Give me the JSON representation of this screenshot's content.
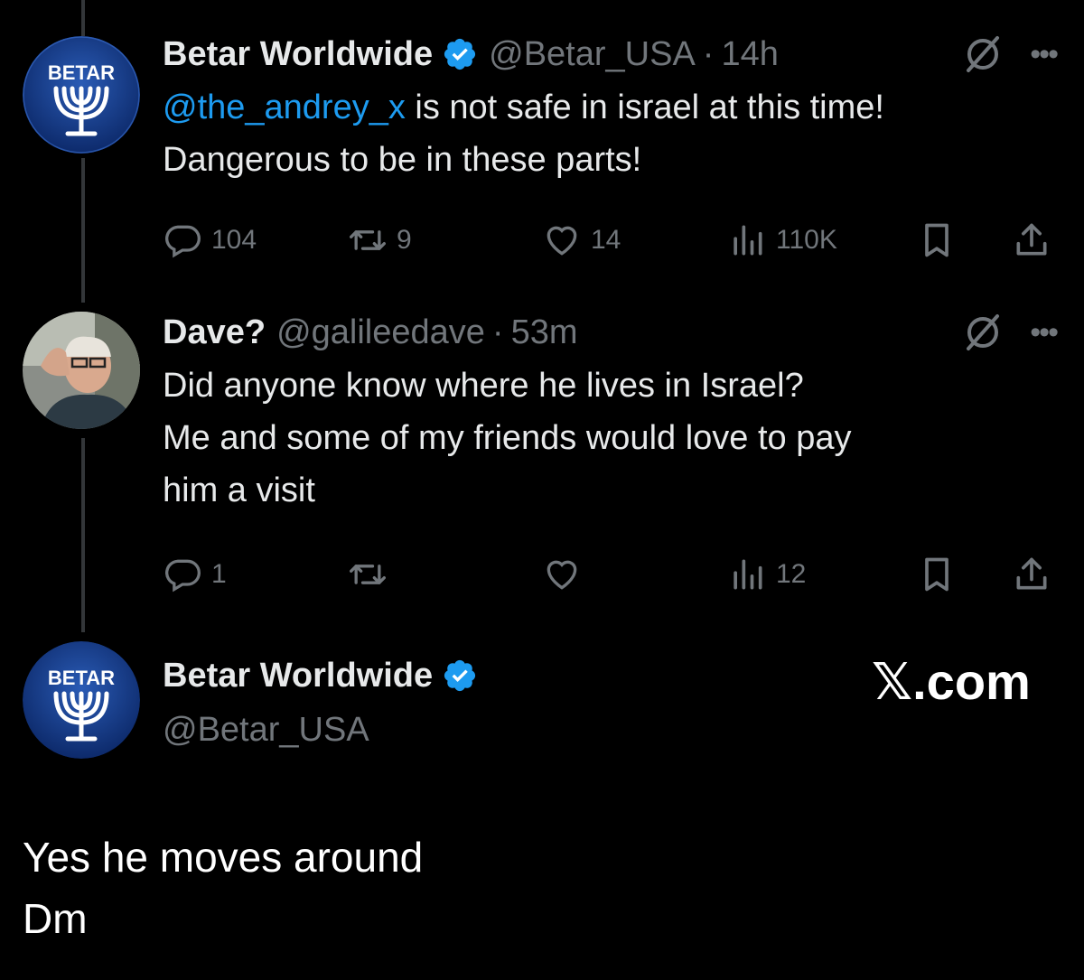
{
  "tweets": [
    {
      "name": "Betar Worldwide",
      "handle": "@Betar_USA",
      "dot": "·",
      "time": "14h",
      "mention": "@the_andrey_x",
      "text_line1_rest": " is not safe in israel at this time!",
      "text_line2": "Dangerous to be in these parts!",
      "replies": "104",
      "retweets": "9",
      "likes": "14",
      "views": "110K",
      "avatar_label": "BETAR"
    },
    {
      "name": "Dave?",
      "handle": "@galileedave",
      "dot": "·",
      "time": "53m",
      "text_line1": "Did anyone know where he lives in Israel?",
      "text_line2": "Me and some of my friends would love to pay",
      "text_line3": "him a visit",
      "replies": "1",
      "retweets": "",
      "likes": "",
      "views": "12"
    }
  ],
  "quote_author": {
    "name": "Betar Worldwide",
    "handle": "@Betar_USA",
    "avatar_label": "BETAR"
  },
  "x_brand": "𝕏.com",
  "reply": {
    "line1": "Yes he moves around",
    "line2": "Dm"
  },
  "colors": {
    "background": "#000000",
    "link": "#1d9bf0",
    "verified": "#1d9bf0",
    "muted": "#71767b"
  },
  "icons": [
    "verified-badge-icon",
    "grok-icon",
    "more-icon",
    "reply-icon",
    "retweet-icon",
    "like-icon",
    "views-icon",
    "bookmark-icon",
    "share-icon"
  ]
}
